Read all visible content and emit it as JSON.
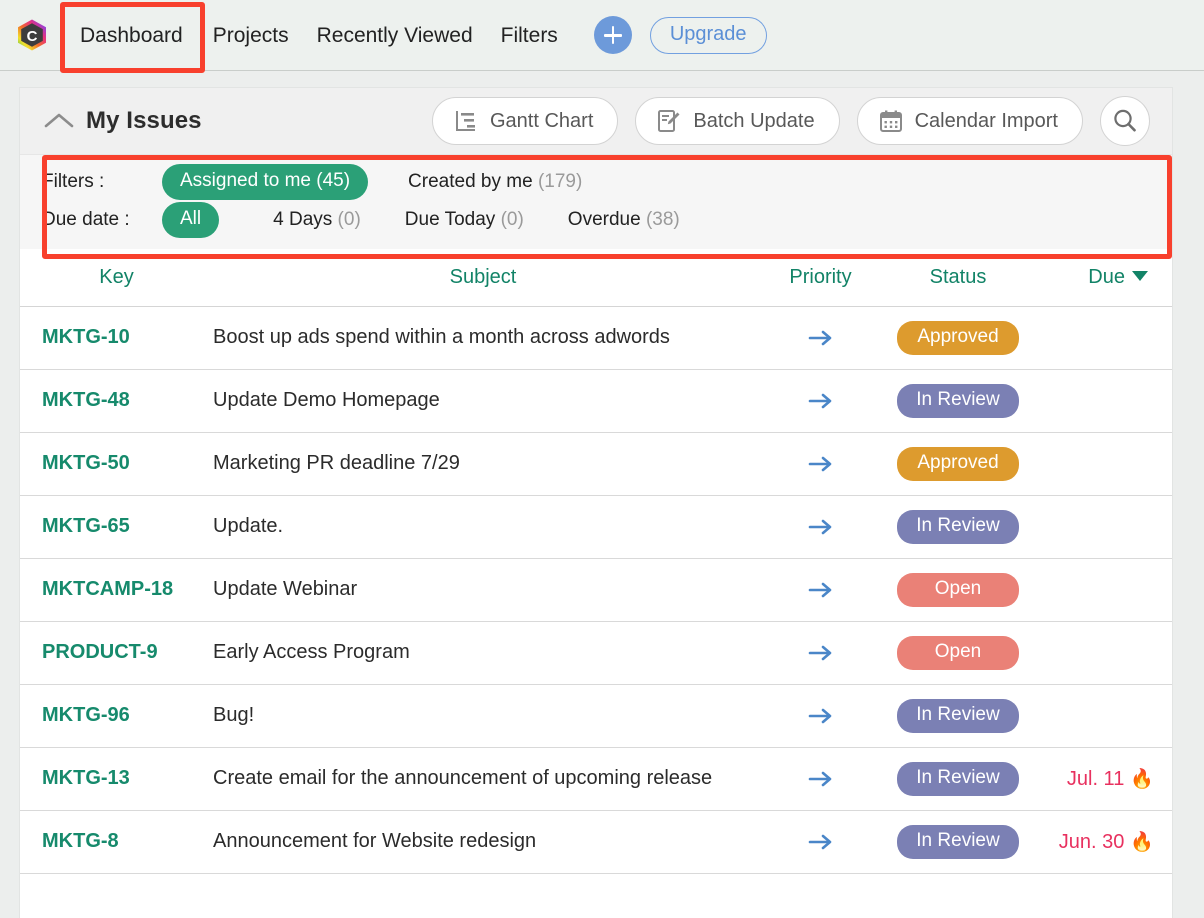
{
  "brand": {
    "logo_icon": "backlog-hexagon-logo",
    "logo_letter": "C"
  },
  "topnav": {
    "items": [
      {
        "label": "Dashboard",
        "active": true
      },
      {
        "label": "Projects",
        "active": false
      },
      {
        "label": "Recently Viewed",
        "active": false
      },
      {
        "label": "Filters",
        "active": false
      }
    ],
    "add_icon": "plus-icon",
    "upgrade_label": "Upgrade"
  },
  "panel": {
    "collapse_icon": "chevron-up-icon",
    "title": "My Issues",
    "actions": [
      {
        "label": "Gantt Chart",
        "icon": "gantt-chart-icon"
      },
      {
        "label": "Batch Update",
        "icon": "batch-update-icon"
      },
      {
        "label": "Calendar Import",
        "icon": "calendar-icon"
      }
    ],
    "search_icon": "search-icon"
  },
  "filters": {
    "filters_label": "Filters :",
    "due_date_label": "Due date :",
    "filter_options": [
      {
        "label": "Assigned to me",
        "count": "(45)",
        "selected": true
      },
      {
        "label": "Created by me",
        "count": "(179)",
        "selected": false
      }
    ],
    "due_options": [
      {
        "label": "All",
        "count": "",
        "selected": true
      },
      {
        "label": "4 Days",
        "count": "(0)",
        "selected": false
      },
      {
        "label": "Due Today",
        "count": "(0)",
        "selected": false
      },
      {
        "label": "Overdue",
        "count": "(38)",
        "selected": false
      }
    ]
  },
  "table": {
    "columns": [
      "Key",
      "Subject",
      "Priority",
      "Status",
      "Due"
    ],
    "sorted_column": "Due",
    "sort_direction": "desc",
    "priority_icon": "arrow-right-icon",
    "overdue_icon": "fire-icon",
    "rows": [
      {
        "key": "MKTG-10",
        "subject": "Boost up ads spend within a month across adwords",
        "status": "Approved",
        "status_class": "b-approved",
        "due": ""
      },
      {
        "key": "MKTG-48",
        "subject": "Update Demo Homepage",
        "status": "In Review",
        "status_class": "b-inreview",
        "due": ""
      },
      {
        "key": "MKTG-50",
        "subject": "Marketing PR deadline 7/29",
        "status": "Approved",
        "status_class": "b-approved",
        "due": ""
      },
      {
        "key": "MKTG-65",
        "subject": "Update.",
        "status": "In Review",
        "status_class": "b-inreview",
        "due": ""
      },
      {
        "key": "MKTCAMP-18",
        "subject": "Update Webinar",
        "status": "Open",
        "status_class": "b-open",
        "due": ""
      },
      {
        "key": "PRODUCT-9",
        "subject": "Early Access Program",
        "status": "Open",
        "status_class": "b-open",
        "due": ""
      },
      {
        "key": "MKTG-96",
        "subject": "Bug!",
        "status": "In Review",
        "status_class": "b-inreview",
        "due": ""
      },
      {
        "key": "MKTG-13",
        "subject": "Create email for the announcement of upcoming release",
        "status": "In Review",
        "status_class": "b-inreview",
        "due": "Jul. 11"
      },
      {
        "key": "MKTG-8",
        "subject": "Announcement for Website redesign",
        "status": "In Review",
        "status_class": "b-inreview",
        "due": "Jun. 30"
      }
    ]
  },
  "colors": {
    "accent_green": "#2ba077",
    "link_green": "#168a6c",
    "approved": "#dd9b2e",
    "in_review": "#7b80b4",
    "open": "#ea8177",
    "due_red": "#e8315f",
    "highlight_red": "#f8402d",
    "priority_blue": "#4a86c8",
    "upgrade_blue": "#5b8fd6"
  }
}
